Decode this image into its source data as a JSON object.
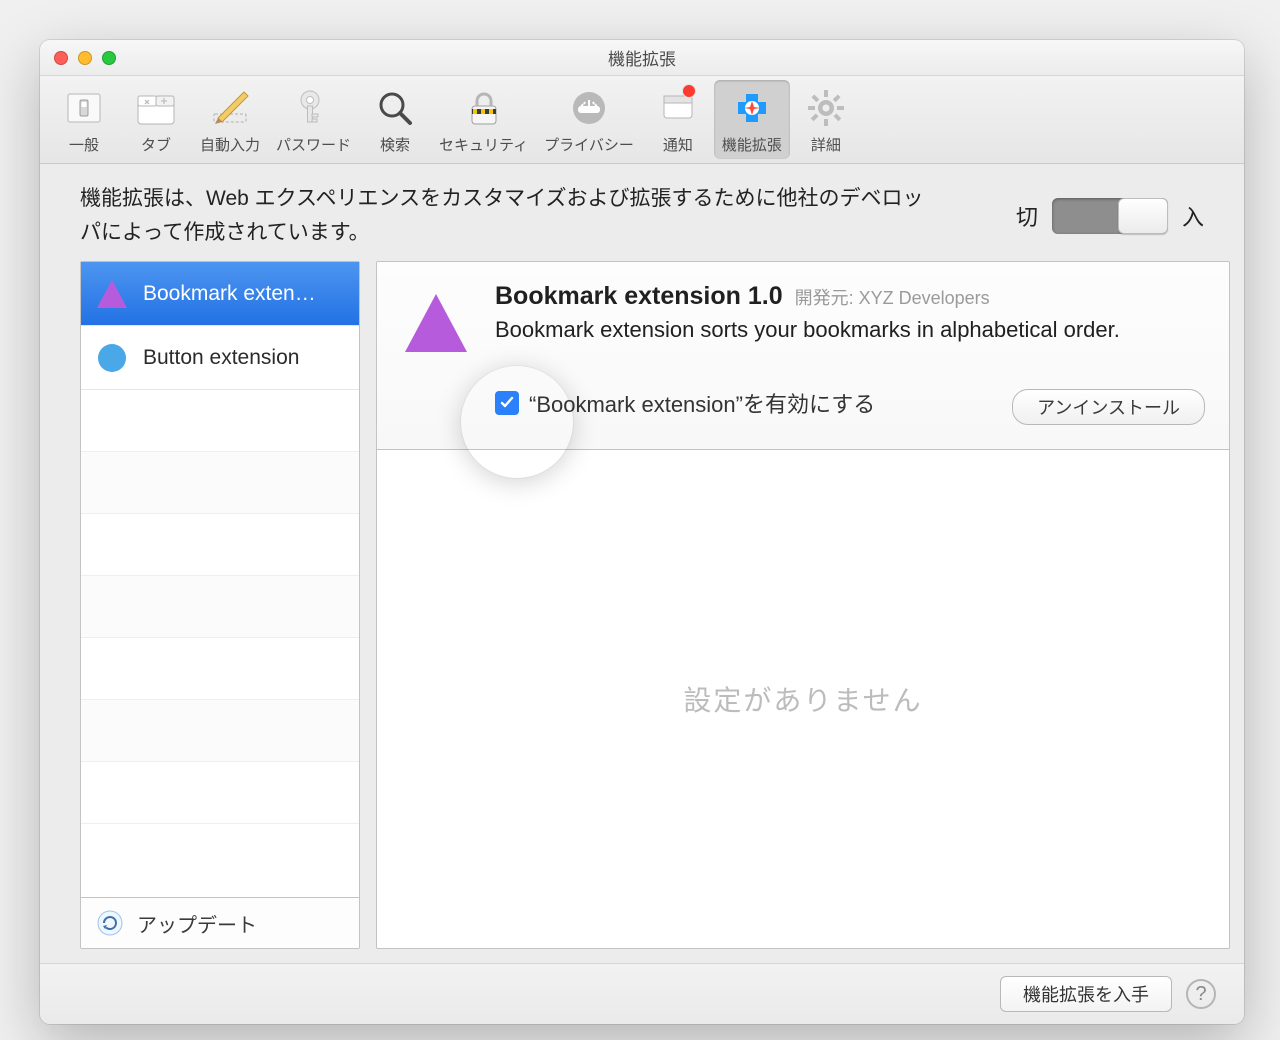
{
  "window": {
    "title": "機能拡張"
  },
  "toolbar": {
    "items": [
      {
        "label": "一般"
      },
      {
        "label": "タブ"
      },
      {
        "label": "自動入力"
      },
      {
        "label": "パスワード"
      },
      {
        "label": "検索"
      },
      {
        "label": "セキュリティ"
      },
      {
        "label": "プライバシー"
      },
      {
        "label": "通知"
      },
      {
        "label": "機能拡張"
      },
      {
        "label": "詳細"
      }
    ]
  },
  "intro": "機能拡張は、Web エクスペリエンスをカスタマイズおよび拡張するために他社のデベロッパによって作成されています。",
  "switch": {
    "off": "切",
    "on": "入"
  },
  "sidebar": {
    "items": [
      {
        "label": "Bookmark exten…"
      },
      {
        "label": "Button extension"
      }
    ],
    "update": "アップデート"
  },
  "detail": {
    "title": "Bookmark extension 1.0",
    "developer_label": "開発元: XYZ Developers",
    "description": "Bookmark extension sorts your bookmarks in alphabetical order.",
    "enable_label": "“Bookmark extension”を有効にする",
    "uninstall": "アンインストール",
    "no_settings": "設定がありません"
  },
  "footer": {
    "get": "機能拡張を入手"
  }
}
